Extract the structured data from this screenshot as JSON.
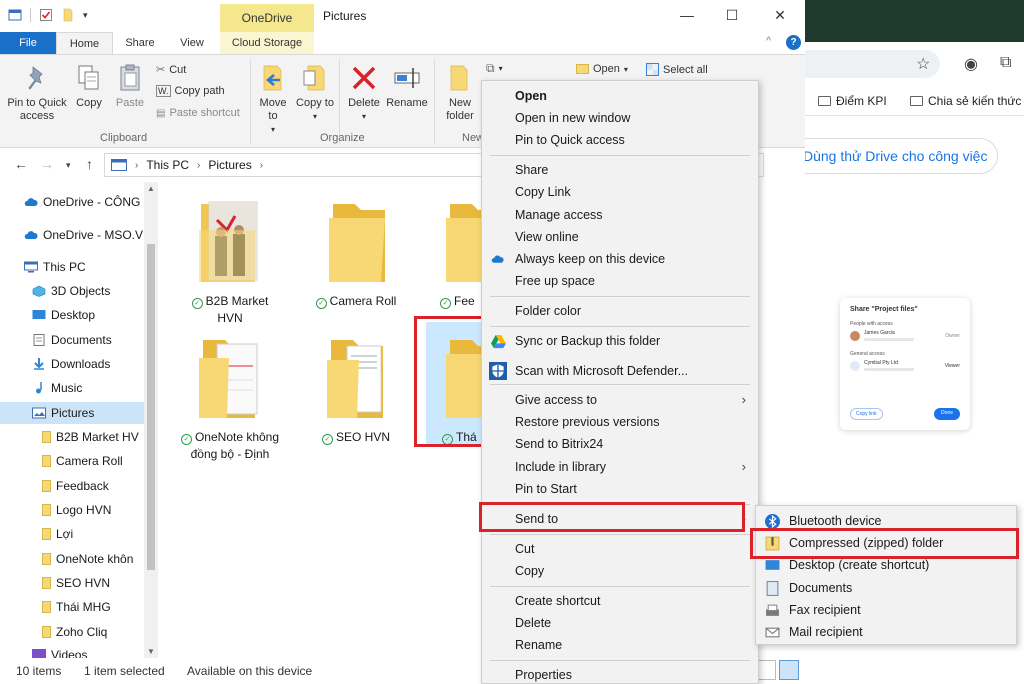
{
  "browser": {
    "bookmarks": [
      "Điểm KPI",
      "Chia sẻ kiến thức"
    ],
    "drive_cta": "Dùng thử Drive cho công việc",
    "share_card": {
      "title": "Share \"Project files\"",
      "people_label": "People with access",
      "person": "James Garcia",
      "person_role": "Owner",
      "general_label": "General access",
      "org": "Cymbal Pty Ltd",
      "org_role": "Viewer",
      "copy_link": "Copy link",
      "done": "Done"
    }
  },
  "window": {
    "title": "Pictures",
    "context_tab_header": "OneDrive",
    "minimize": "—",
    "maximize": "☐",
    "close": "✕"
  },
  "tabs": {
    "file": "File",
    "home": "Home",
    "share": "Share",
    "view": "View",
    "cloud": "Cloud Storage",
    "collapse": "^",
    "help": "?"
  },
  "ribbon": {
    "pin": "Pin to Quick access",
    "copy": "Copy",
    "paste": "Paste",
    "cut": "Cut",
    "copy_path": "Copy path",
    "paste_shortcut": "Paste shortcut",
    "clipboard": "Clipboard",
    "move_to": "Move to",
    "copy_to": "Copy to",
    "delete": "Delete",
    "rename": "Rename",
    "organize": "Organize",
    "new_folder": "New folder",
    "new_group": "New",
    "open": "Open",
    "select_all": "Select all"
  },
  "address": {
    "crumbs": [
      "This PC",
      "Pictures"
    ]
  },
  "nav": {
    "items": [
      "OneDrive - CÔNG",
      "OneDrive - MSO.V",
      "This PC",
      "3D Objects",
      "Desktop",
      "Documents",
      "Downloads",
      "Music",
      "Pictures",
      "B2B Market HV",
      "Camera Roll",
      "Feedback",
      "Logo HVN",
      "Lợi",
      "OneNote khôn",
      "SEO HVN",
      "Thái MHG",
      "Zoho Cliq",
      "Videos"
    ]
  },
  "files": [
    {
      "name": "B2B Market HVN"
    },
    {
      "name": "Camera Roll"
    },
    {
      "name": "Fee"
    },
    {
      "name": "OneNote không đồng bộ - Định"
    },
    {
      "name": "SEO HVN"
    },
    {
      "name": "Thá"
    }
  ],
  "context_menu": {
    "items": [
      "Open",
      "Open in new window",
      "Pin to Quick access",
      "Share",
      "Copy Link",
      "Manage access",
      "View online",
      "Always keep on this device",
      "Free up space",
      "Folder color",
      "Sync or Backup this folder",
      "Scan with Microsoft Defender...",
      "Give access to",
      "Restore previous versions",
      "Send to Bitrix24",
      "Include in library",
      "Pin to Start",
      "Send to",
      "Cut",
      "Copy",
      "Create shortcut",
      "Delete",
      "Rename",
      "Properties"
    ],
    "submenu_arrow": "›"
  },
  "send_to": {
    "items": [
      "Bluetooth device",
      "Compressed (zipped) folder",
      "Desktop (create shortcut)",
      "Documents",
      "Fax recipient",
      "Mail recipient"
    ]
  },
  "status": {
    "count": "10 items",
    "selected": "1 item selected",
    "availability": "Available on this device"
  },
  "colors": {
    "accent": "#1a6fc9",
    "highlight": "#d8232a",
    "selected_bg": "#cce4f7",
    "folder": "#f8d775",
    "onedrive_tab": "#f4e78e"
  }
}
